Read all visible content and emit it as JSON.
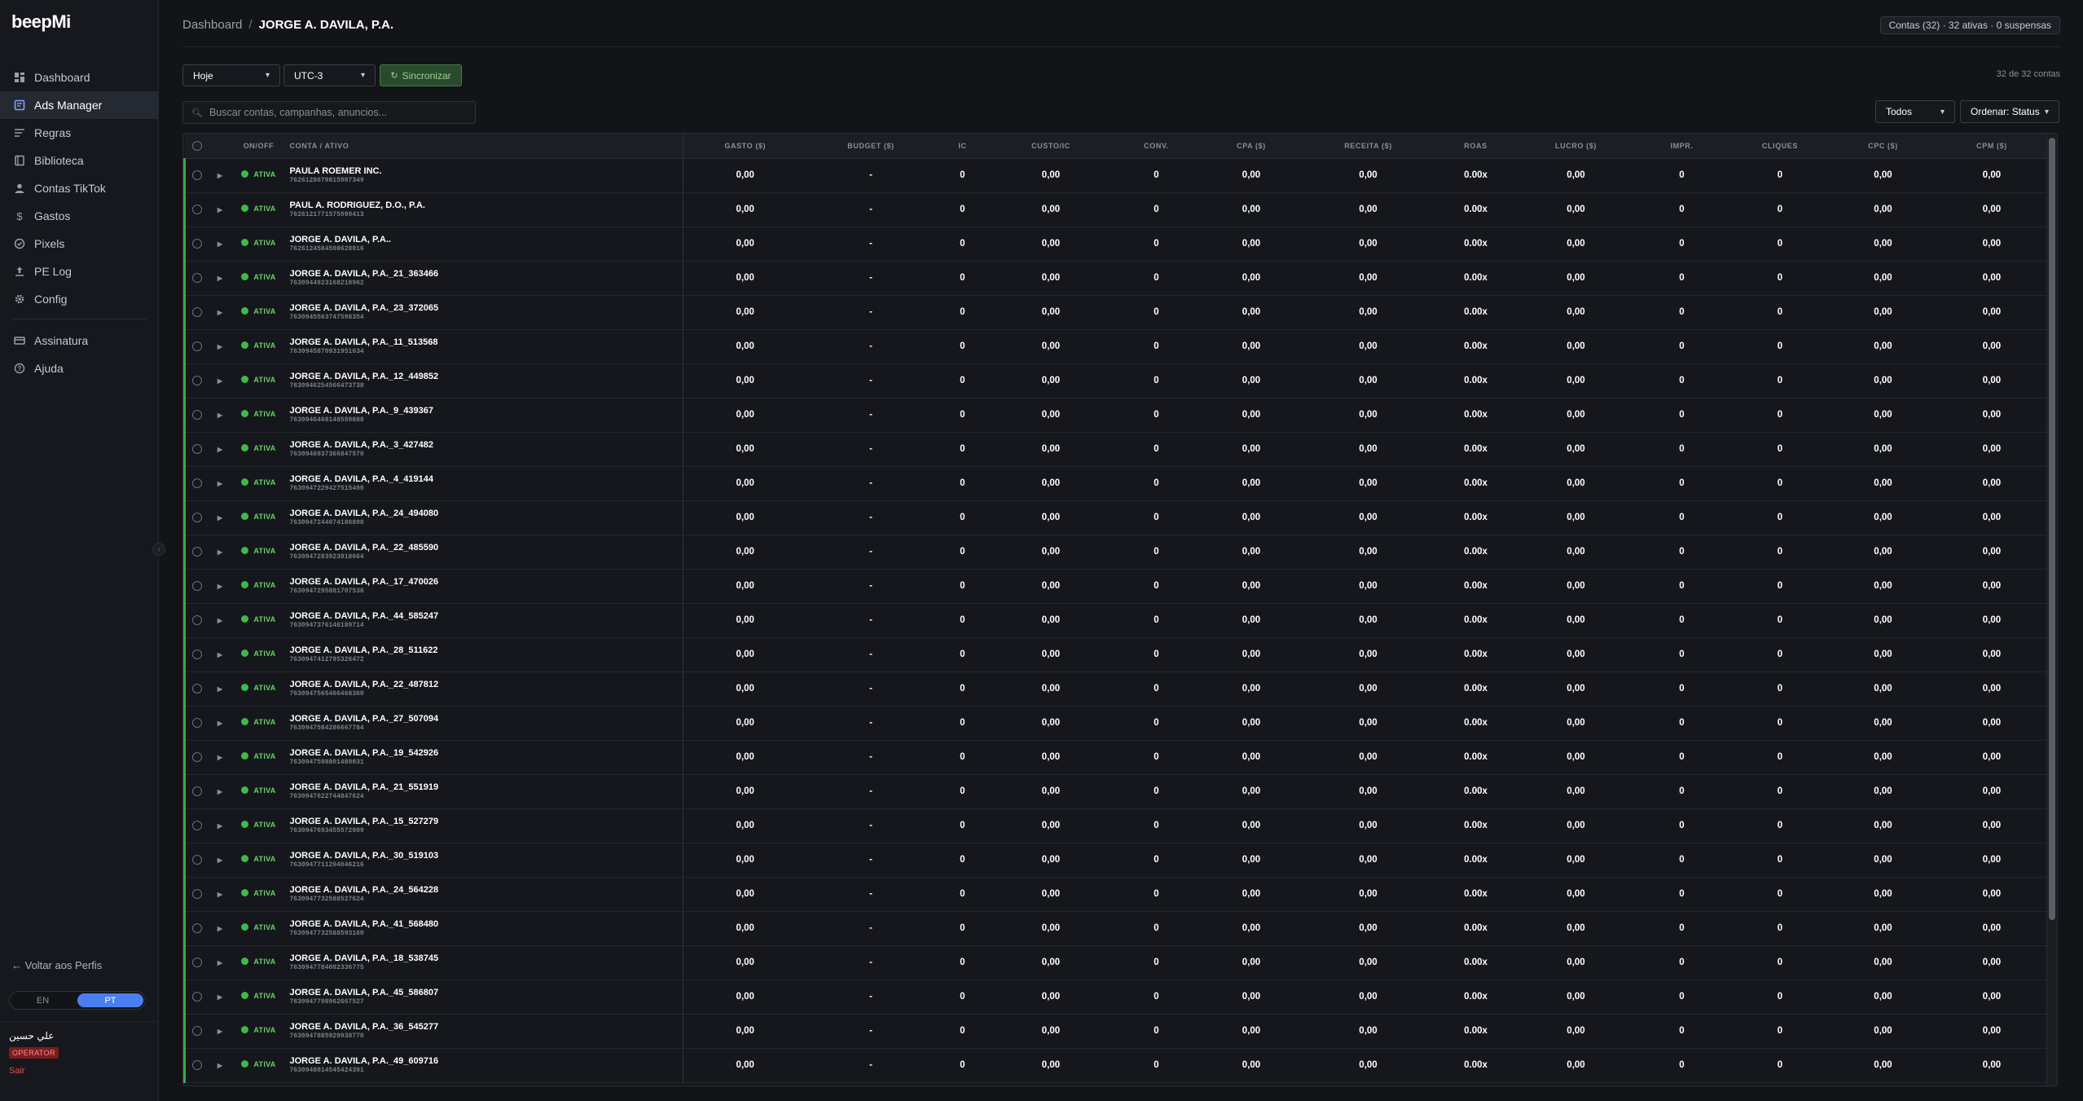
{
  "app": {
    "logo": "beepMi"
  },
  "sidebar": {
    "items": [
      {
        "label": "Dashboard",
        "icon": "dashboard-icon",
        "active": false
      },
      {
        "label": "Ads Manager",
        "icon": "ads-manager-icon",
        "active": true
      },
      {
        "label": "Regras",
        "icon": "rules-icon",
        "active": false
      },
      {
        "label": "Biblioteca",
        "icon": "library-icon",
        "active": false
      },
      {
        "label": "Contas TikTok",
        "icon": "user-icon",
        "active": false
      },
      {
        "label": "Gastos",
        "icon": "dollar-icon",
        "active": false
      },
      {
        "label": "Pixels",
        "icon": "pixel-icon",
        "active": false
      },
      {
        "label": "PE Log",
        "icon": "upload-log-icon",
        "active": false
      },
      {
        "label": "Config",
        "icon": "gear-icon",
        "active": false
      }
    ],
    "items2": [
      {
        "label": "Assinatura",
        "icon": "card-icon"
      },
      {
        "label": "Ajuda",
        "icon": "help-icon"
      }
    ],
    "back_label": "← Voltar aos Perfis",
    "lang": {
      "en": "EN",
      "pt": "PT",
      "selected": "PT"
    },
    "user": {
      "name": "علي حسين",
      "role": "OPERATOR",
      "logout": "Sair"
    }
  },
  "header": {
    "breadcrumb_root": "Dashboard",
    "breadcrumb_sep": "/",
    "breadcrumb_current": "JORGE A. DAVILA, P.A.",
    "summary": "Contas (32) · 32 ativas · 0 suspensas"
  },
  "toolbar": {
    "date_range": "Hoje",
    "timezone": "UTC-3",
    "sync_label": "Sincronizar",
    "count_label": "32 de 32 contas",
    "search_placeholder": "Buscar contas, campanhas, anuncios...",
    "filter": "Todos",
    "sort": "Ordenar: Status"
  },
  "table": {
    "columns": [
      "",
      "",
      "ON/OFF",
      "CONTA / ATIVO",
      "GASTO ($)",
      "BUDGET ($)",
      "IC",
      "CUSTO/IC",
      "CONV.",
      "CPA ($)",
      "RECEITA ($)",
      "ROAS",
      "LUCRO ($)",
      "IMPR.",
      "CLIQUES",
      "CPC ($)",
      "CPM ($)"
    ],
    "status_label": "ATIVA",
    "rows": [
      {
        "name": "PAULA ROEMER INC.",
        "id": "7626128679815907349",
        "gasto": "0,00",
        "budget": "-",
        "ic": "0",
        "custo_ic": "0,00",
        "conv": "0",
        "cpa": "0,00",
        "receita": "0,00",
        "roas": "0.00x",
        "lucro": "0,00",
        "impr": "0",
        "cliques": "0",
        "cpc": "0,00",
        "cpm": "0,00"
      },
      {
        "name": "PAUL A. RODRIGUEZ, D.O., P.A.",
        "id": "7626121771575099413",
        "gasto": "0,00",
        "budget": "-",
        "ic": "0",
        "custo_ic": "0,00",
        "conv": "0",
        "cpa": "0,00",
        "receita": "0,00",
        "roas": "0.00x",
        "lucro": "0,00",
        "impr": "0",
        "cliques": "0",
        "cpc": "0,00",
        "cpm": "0,00"
      },
      {
        "name": "JORGE A. DAVILA, P.A..",
        "id": "7626124584508628016",
        "gasto": "0,00",
        "budget": "-",
        "ic": "0",
        "custo_ic": "0,00",
        "conv": "0",
        "cpa": "0,00",
        "receita": "0,00",
        "roas": "0.00x",
        "lucro": "0,00",
        "impr": "0",
        "cliques": "0",
        "cpc": "0,00",
        "cpm": "0,00"
      },
      {
        "name": "JORGE A. DAVILA, P.A._21_363466",
        "id": "7630944923168210962",
        "gasto": "0,00",
        "budget": "-",
        "ic": "0",
        "custo_ic": "0,00",
        "conv": "0",
        "cpa": "0,00",
        "receita": "0,00",
        "roas": "0.00x",
        "lucro": "0,00",
        "impr": "0",
        "cliques": "0",
        "cpc": "0,00",
        "cpm": "0,00"
      },
      {
        "name": "JORGE A. DAVILA, P.A._23_372065",
        "id": "7630945563747598354",
        "gasto": "0,00",
        "budget": "-",
        "ic": "0",
        "custo_ic": "0,00",
        "conv": "0",
        "cpa": "0,00",
        "receita": "0,00",
        "roas": "0.00x",
        "lucro": "0,00",
        "impr": "0",
        "cliques": "0",
        "cpc": "0,00",
        "cpm": "0,00"
      },
      {
        "name": "JORGE A. DAVILA, P.A._11_513568",
        "id": "7630945870931951634",
        "gasto": "0,00",
        "budget": "-",
        "ic": "0",
        "custo_ic": "0,00",
        "conv": "0",
        "cpa": "0,00",
        "receita": "0,00",
        "roas": "0.00x",
        "lucro": "0,00",
        "impr": "0",
        "cliques": "0",
        "cpc": "0,00",
        "cpm": "0,00"
      },
      {
        "name": "JORGE A. DAVILA, P.A._12_449852",
        "id": "7630946254566473738",
        "gasto": "0,00",
        "budget": "-",
        "ic": "0",
        "custo_ic": "0,00",
        "conv": "0",
        "cpa": "0,00",
        "receita": "0,00",
        "roas": "0.00x",
        "lucro": "0,00",
        "impr": "0",
        "cliques": "0",
        "cpc": "0,00",
        "cpm": "0,00"
      },
      {
        "name": "JORGE A. DAVILA, P.A._9_439367",
        "id": "7630946468148559888",
        "gasto": "0,00",
        "budget": "-",
        "ic": "0",
        "custo_ic": "0,00",
        "conv": "0",
        "cpa": "0,00",
        "receita": "0,00",
        "roas": "0.00x",
        "lucro": "0,00",
        "impr": "0",
        "cliques": "0",
        "cpc": "0,00",
        "cpm": "0,00"
      },
      {
        "name": "JORGE A. DAVILA, P.A._3_427482",
        "id": "7630946937366847570",
        "gasto": "0,00",
        "budget": "-",
        "ic": "0",
        "custo_ic": "0,00",
        "conv": "0",
        "cpa": "0,00",
        "receita": "0,00",
        "roas": "0.00x",
        "lucro": "0,00",
        "impr": "0",
        "cliques": "0",
        "cpc": "0,00",
        "cpm": "0,00"
      },
      {
        "name": "JORGE A. DAVILA, P.A._4_419144",
        "id": "7630947229427515400",
        "gasto": "0,00",
        "budget": "-",
        "ic": "0",
        "custo_ic": "0,00",
        "conv": "0",
        "cpa": "0,00",
        "receita": "0,00",
        "roas": "0.00x",
        "lucro": "0,00",
        "impr": "0",
        "cliques": "0",
        "cpc": "0,00",
        "cpm": "0,00"
      },
      {
        "name": "JORGE A. DAVILA, P.A._24_494080",
        "id": "7630947244074186898",
        "gasto": "0,00",
        "budget": "-",
        "ic": "0",
        "custo_ic": "0,00",
        "conv": "0",
        "cpa": "0,00",
        "receita": "0,00",
        "roas": "0.00x",
        "lucro": "0,00",
        "impr": "0",
        "cliques": "0",
        "cpc": "0,00",
        "cpm": "0,00"
      },
      {
        "name": "JORGE A. DAVILA, P.A._22_485590",
        "id": "7630947283923918664",
        "gasto": "0,00",
        "budget": "-",
        "ic": "0",
        "custo_ic": "0,00",
        "conv": "0",
        "cpa": "0,00",
        "receita": "0,00",
        "roas": "0.00x",
        "lucro": "0,00",
        "impr": "0",
        "cliques": "0",
        "cpc": "0,00",
        "cpm": "0,00"
      },
      {
        "name": "JORGE A. DAVILA, P.A._17_470026",
        "id": "7630947295881707538",
        "gasto": "0,00",
        "budget": "-",
        "ic": "0",
        "custo_ic": "0,00",
        "conv": "0",
        "cpa": "0,00",
        "receita": "0,00",
        "roas": "0.00x",
        "lucro": "0,00",
        "impr": "0",
        "cliques": "0",
        "cpc": "0,00",
        "cpm": "0,00"
      },
      {
        "name": "JORGE A. DAVILA, P.A._44_585247",
        "id": "7630947376148189714",
        "gasto": "0,00",
        "budget": "-",
        "ic": "0",
        "custo_ic": "0,00",
        "conv": "0",
        "cpa": "0,00",
        "receita": "0,00",
        "roas": "0.00x",
        "lucro": "0,00",
        "impr": "0",
        "cliques": "0",
        "cpc": "0,00",
        "cpm": "0,00"
      },
      {
        "name": "JORGE A. DAVILA, P.A._28_511622",
        "id": "7630947412795326472",
        "gasto": "0,00",
        "budget": "-",
        "ic": "0",
        "custo_ic": "0,00",
        "conv": "0",
        "cpa": "0,00",
        "receita": "0,00",
        "roas": "0.00x",
        "lucro": "0,00",
        "impr": "0",
        "cliques": "0",
        "cpc": "0,00",
        "cpm": "0,00"
      },
      {
        "name": "JORGE A. DAVILA, P.A._22_487812",
        "id": "7630947565466468360",
        "gasto": "0,00",
        "budget": "-",
        "ic": "0",
        "custo_ic": "0,00",
        "conv": "0",
        "cpa": "0,00",
        "receita": "0,00",
        "roas": "0.00x",
        "lucro": "0,00",
        "impr": "0",
        "cliques": "0",
        "cpc": "0,00",
        "cpm": "0,00"
      },
      {
        "name": "JORGE A. DAVILA, P.A._27_507094",
        "id": "7630947584286667784",
        "gasto": "0,00",
        "budget": "-",
        "ic": "0",
        "custo_ic": "0,00",
        "conv": "0",
        "cpa": "0,00",
        "receita": "0,00",
        "roas": "0.00x",
        "lucro": "0,00",
        "impr": "0",
        "cliques": "0",
        "cpc": "0,00",
        "cpm": "0,00"
      },
      {
        "name": "JORGE A. DAVILA, P.A._19_542926",
        "id": "7630947598801489031",
        "gasto": "0,00",
        "budget": "-",
        "ic": "0",
        "custo_ic": "0,00",
        "conv": "0",
        "cpa": "0,00",
        "receita": "0,00",
        "roas": "0.00x",
        "lucro": "0,00",
        "impr": "0",
        "cliques": "0",
        "cpc": "0,00",
        "cpm": "0,00"
      },
      {
        "name": "JORGE A. DAVILA, P.A._21_551919",
        "id": "7630947622744847624",
        "gasto": "0,00",
        "budget": "-",
        "ic": "0",
        "custo_ic": "0,00",
        "conv": "0",
        "cpa": "0,00",
        "receita": "0,00",
        "roas": "0.00x",
        "lucro": "0,00",
        "impr": "0",
        "cliques": "0",
        "cpc": "0,00",
        "cpm": "0,00"
      },
      {
        "name": "JORGE A. DAVILA, P.A._15_527279",
        "id": "7630947693455572999",
        "gasto": "0,00",
        "budget": "-",
        "ic": "0",
        "custo_ic": "0,00",
        "conv": "0",
        "cpa": "0,00",
        "receita": "0,00",
        "roas": "0.00x",
        "lucro": "0,00",
        "impr": "0",
        "cliques": "0",
        "cpc": "0,00",
        "cpm": "0,00"
      },
      {
        "name": "JORGE A. DAVILA, P.A._30_519103",
        "id": "7630947711294046216",
        "gasto": "0,00",
        "budget": "-",
        "ic": "0",
        "custo_ic": "0,00",
        "conv": "0",
        "cpa": "0,00",
        "receita": "0,00",
        "roas": "0.00x",
        "lucro": "0,00",
        "impr": "0",
        "cliques": "0",
        "cpc": "0,00",
        "cpm": "0,00"
      },
      {
        "name": "JORGE A. DAVILA, P.A._24_564228",
        "id": "7630947732588527624",
        "gasto": "0,00",
        "budget": "-",
        "ic": "0",
        "custo_ic": "0,00",
        "conv": "0",
        "cpa": "0,00",
        "receita": "0,00",
        "roas": "0.00x",
        "lucro": "0,00",
        "impr": "0",
        "cliques": "0",
        "cpc": "0,00",
        "cpm": "0,00"
      },
      {
        "name": "JORGE A. DAVILA, P.A._41_568480",
        "id": "7630947732588593160",
        "gasto": "0,00",
        "budget": "-",
        "ic": "0",
        "custo_ic": "0,00",
        "conv": "0",
        "cpa": "0,00",
        "receita": "0,00",
        "roas": "0.00x",
        "lucro": "0,00",
        "impr": "0",
        "cliques": "0",
        "cpc": "0,00",
        "cpm": "0,00"
      },
      {
        "name": "JORGE A. DAVILA, P.A._18_538745",
        "id": "7630947784082336775",
        "gasto": "0,00",
        "budget": "-",
        "ic": "0",
        "custo_ic": "0,00",
        "conv": "0",
        "cpa": "0,00",
        "receita": "0,00",
        "roas": "0.00x",
        "lucro": "0,00",
        "impr": "0",
        "cliques": "0",
        "cpc": "0,00",
        "cpm": "0,00"
      },
      {
        "name": "JORGE A. DAVILA, P.A._45_586807",
        "id": "7630947798962667527",
        "gasto": "0,00",
        "budget": "-",
        "ic": "0",
        "custo_ic": "0,00",
        "conv": "0",
        "cpa": "0,00",
        "receita": "0,00",
        "roas": "0.00x",
        "lucro": "0,00",
        "impr": "0",
        "cliques": "0",
        "cpc": "0,00",
        "cpm": "0,00"
      },
      {
        "name": "JORGE A. DAVILA, P.A._36_545277",
        "id": "7630947885929938770",
        "gasto": "0,00",
        "budget": "-",
        "ic": "0",
        "custo_ic": "0,00",
        "conv": "0",
        "cpa": "0,00",
        "receita": "0,00",
        "roas": "0.00x",
        "lucro": "0,00",
        "impr": "0",
        "cliques": "0",
        "cpc": "0,00",
        "cpm": "0,00"
      },
      {
        "name": "JORGE A. DAVILA, P.A._49_609716",
        "id": "7630948014545424391",
        "gasto": "0,00",
        "budget": "-",
        "ic": "0",
        "custo_ic": "0,00",
        "conv": "0",
        "cpa": "0,00",
        "receita": "0,00",
        "roas": "0.00x",
        "lucro": "0,00",
        "impr": "0",
        "cliques": "0",
        "cpc": "0,00",
        "cpm": "0,00"
      }
    ]
  }
}
